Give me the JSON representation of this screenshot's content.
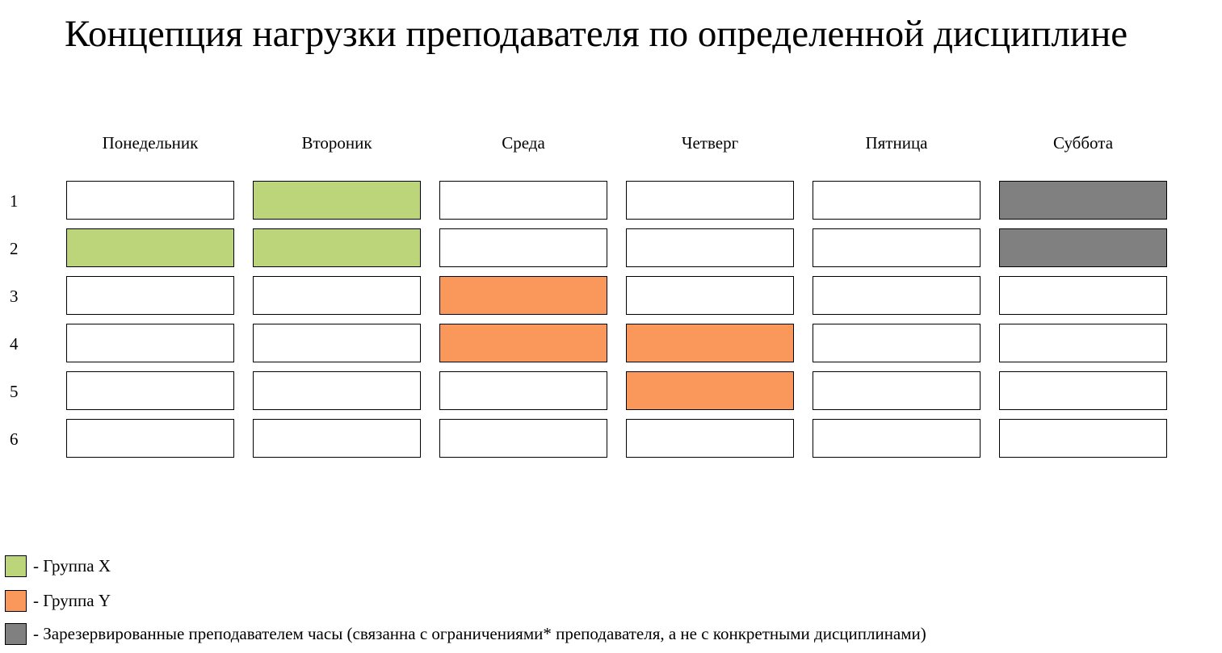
{
  "title": "Концепция нагрузки преподавателя по определенной дисциплине",
  "colors": {
    "empty": "#ffffff",
    "group_x": "#bcd47a",
    "group_y": "#fa985c",
    "reserved": "#808080"
  },
  "days": [
    "Понедельник",
    "Вторoник",
    "Среда",
    "Четверг",
    "Пятница",
    "Суббота"
  ],
  "rows": [
    "1",
    "2",
    "3",
    "4",
    "5",
    "6"
  ],
  "schedule": [
    [
      "empty",
      "group_x",
      "empty",
      "empty",
      "empty",
      "reserved"
    ],
    [
      "group_x",
      "group_x",
      "empty",
      "empty",
      "empty",
      "reserved"
    ],
    [
      "empty",
      "empty",
      "group_y",
      "empty",
      "empty",
      "empty"
    ],
    [
      "empty",
      "empty",
      "group_y",
      "group_y",
      "empty",
      "empty"
    ],
    [
      "empty",
      "empty",
      "empty",
      "group_y",
      "empty",
      "empty"
    ],
    [
      "empty",
      "empty",
      "empty",
      "empty",
      "empty",
      "empty"
    ]
  ],
  "legend": [
    {
      "key": "group_x",
      "label": "- Группа  Х"
    },
    {
      "key": "group_y",
      "label": "- Группа Y"
    },
    {
      "key": "reserved",
      "label": "- Зарезервированные преподавателем часы (связанна с ограничениями* преподавателя, а не с конкретными дисциплинами)"
    }
  ]
}
